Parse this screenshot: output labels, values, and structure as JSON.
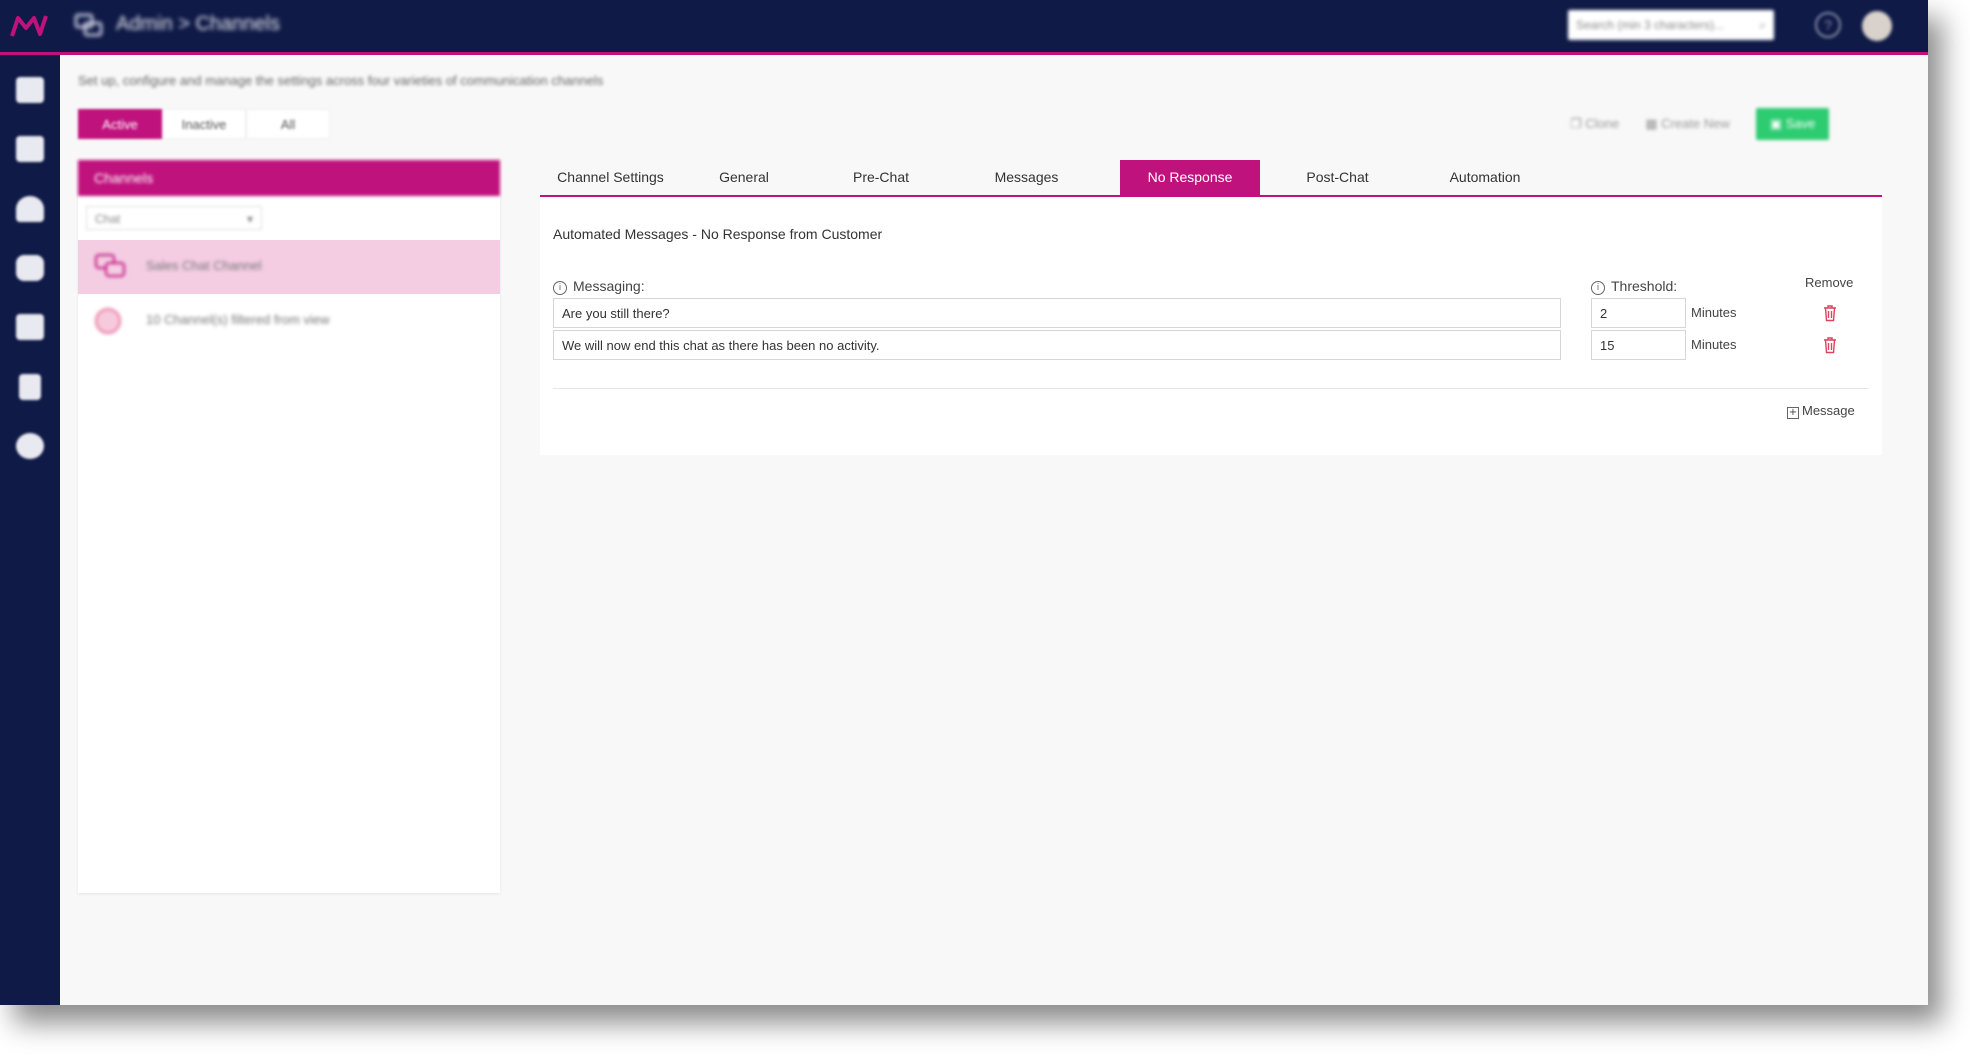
{
  "header": {
    "breadcrumb": "Admin > Channels",
    "search_placeholder": "Search (min 3 characters)...",
    "icons": [
      "logo-icon",
      "channels-icon",
      "search-icon",
      "help-icon",
      "avatar"
    ]
  },
  "nav": {
    "items": [
      "home-icon",
      "list-icon",
      "dashboard-icon",
      "database-icon",
      "inbox-icon",
      "document-icon",
      "settings-icon"
    ]
  },
  "page": {
    "description": "Set up, configure and manage the settings across four varieties of communication channels",
    "filters": [
      "Active",
      "Inactive",
      "All"
    ],
    "active_filter": "Active",
    "actions": {
      "clone": "Clone",
      "create_new": "Create New",
      "save": "Save"
    }
  },
  "channels_panel": {
    "title": "Channels",
    "type_select": "Chat",
    "items": [
      {
        "label": "Sales Chat Channel",
        "selected": true
      },
      {
        "label": "10 Channel(s) filtered from view",
        "selected": false
      }
    ]
  },
  "tabs": [
    "Channel Settings",
    "General",
    "Pre-Chat",
    "Messages",
    "No Response",
    "Post-Chat",
    "Automation"
  ],
  "active_tab": "No Response",
  "no_response": {
    "title": "Automated Messages - No Response from Customer",
    "messaging_label": "Messaging:",
    "threshold_label": "Threshold:",
    "remove_label": "Remove",
    "rows": [
      {
        "message": "Are you still there?",
        "threshold": "2",
        "unit": "Minutes"
      },
      {
        "message": "We will now end this chat as there has been no activity.",
        "threshold": "15",
        "unit": "Minutes"
      }
    ],
    "add_label": "Message"
  },
  "colors": {
    "brand": "#c0127d",
    "nav": "#0f1a47",
    "save": "#2ecc71",
    "danger": "#e0415b"
  }
}
